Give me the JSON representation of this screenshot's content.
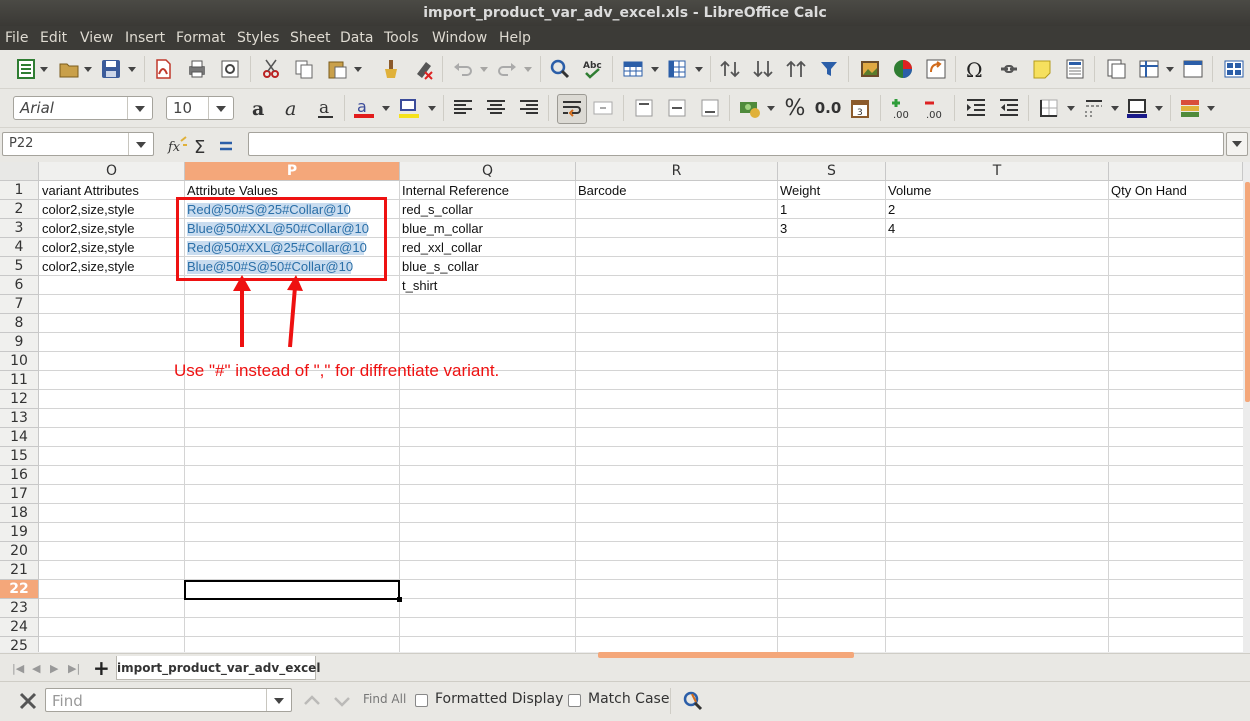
{
  "window": {
    "title": "import_product_var_adv_excel.xls - LibreOffice Calc"
  },
  "menu": [
    "File",
    "Edit",
    "View",
    "Insert",
    "Format",
    "Styles",
    "Sheet",
    "Data",
    "Tools",
    "Window",
    "Help"
  ],
  "toolbar": {
    "font_name": "Arial",
    "font_size": "10",
    "percent_label": "%",
    "decimal_label": "0.0"
  },
  "formula_bar": {
    "name_box": "P22",
    "formula": ""
  },
  "columns": [
    "O",
    "P",
    "Q",
    "R",
    "S",
    "T"
  ],
  "active_column": "P",
  "active_cell": "P22",
  "active_row": "22",
  "rows": [
    "1",
    "2",
    "3",
    "4",
    "5",
    "6",
    "7",
    "8",
    "9",
    "10",
    "11",
    "12",
    "13",
    "14",
    "15",
    "16",
    "17",
    "18",
    "19",
    "20",
    "21",
    "22",
    "23",
    "24",
    "25"
  ],
  "cells": {
    "O1": "variant Attributes",
    "P1": "Attribute Values",
    "Q1": "Internal Reference",
    "R1": "Barcode",
    "S1": "Weight",
    "T1": "Volume",
    "U1": "Qty On Hand",
    "O2": "color2,size,style",
    "P2": "Red@50#S@25#Collar@10",
    "Q2": "red_s_collar",
    "S2": "1",
    "T2": "2",
    "O3": "color2,size,style",
    "P3": "Blue@50#XXL@50#Collar@10",
    "Q3": "blue_m_collar",
    "S3": "3",
    "T3": "4",
    "O4": "color2,size,style",
    "P4": "Red@50#XXL@25#Collar@10",
    "Q4": "red_xxl_collar",
    "O5": "color2,size,style",
    "P5": "Blue@50#S@50#Collar@10",
    "Q5": "blue_s_collar",
    "Q6": "t_shirt"
  },
  "annotation": {
    "text": "Use \"#\" instead of \",\" for diffrentiate variant.",
    "color": "#ee1111"
  },
  "sheet_tabs": [
    "import_product_var_adv_excel"
  ],
  "find_bar": {
    "placeholder": "Find",
    "find_all": "Find All",
    "formatted_display": "Formatted Display",
    "match_case": "Match Case"
  },
  "colors": {
    "accent": "#f4a77a",
    "annotation_red": "#ee1111",
    "selection_text": "#2a6fa8"
  }
}
